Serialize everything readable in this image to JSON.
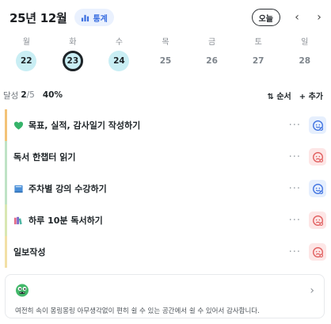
{
  "header": {
    "month": "25년 12월",
    "stats_label": "통계",
    "today_label": "오늘",
    "prev_arrow": "‹",
    "next_arrow": "›"
  },
  "week": [
    {
      "weekday": "월",
      "date": "22",
      "state": "done"
    },
    {
      "weekday": "화",
      "date": "23",
      "state": "selected"
    },
    {
      "weekday": "수",
      "date": "24",
      "state": "done"
    },
    {
      "weekday": "목",
      "date": "25",
      "state": "none"
    },
    {
      "weekday": "금",
      "date": "26",
      "state": "none"
    },
    {
      "weekday": "토",
      "date": "27",
      "state": "none"
    },
    {
      "weekday": "일",
      "date": "28",
      "state": "none"
    }
  ],
  "summary": {
    "label": "달성",
    "done": "2",
    "total": "/5",
    "percent": "40%",
    "sort_label": "⇅ 순서",
    "add_label": "+ 추가"
  },
  "tasks": [
    {
      "emoji": "green-heart-icon",
      "title": "목표, 실적, 감사일기 작성하기",
      "status": "success",
      "accent": "#f3c277"
    },
    {
      "emoji": "",
      "title": "독서 한챕터 읽기",
      "status": "fail",
      "accent": "#bfe3c5"
    },
    {
      "emoji": "book-icon",
      "title": "주차별 강의 수강하기",
      "status": "success",
      "accent": "#bfe3c5"
    },
    {
      "emoji": "books-icon",
      "title": "하루 10분 독서하기",
      "status": "fail",
      "accent": "#d9e7b3"
    },
    {
      "emoji": "",
      "title": "일보작성",
      "status": "fail",
      "accent": "#f2e0a6"
    }
  ],
  "task_more": "···",
  "card": {
    "icon": "mascot-icon",
    "message": "여전히 속이 몽링몽링 아무생각없이 편히 쉴 수 있는 공간에서 쉴 수 있어서 감사합니다.",
    "chevron": "›"
  },
  "colors": {
    "accent_blue": "#3b6fe0",
    "done_day": "#c9eef4",
    "success_bg": "#e6effd",
    "fail_bg": "#fde6e6"
  }
}
